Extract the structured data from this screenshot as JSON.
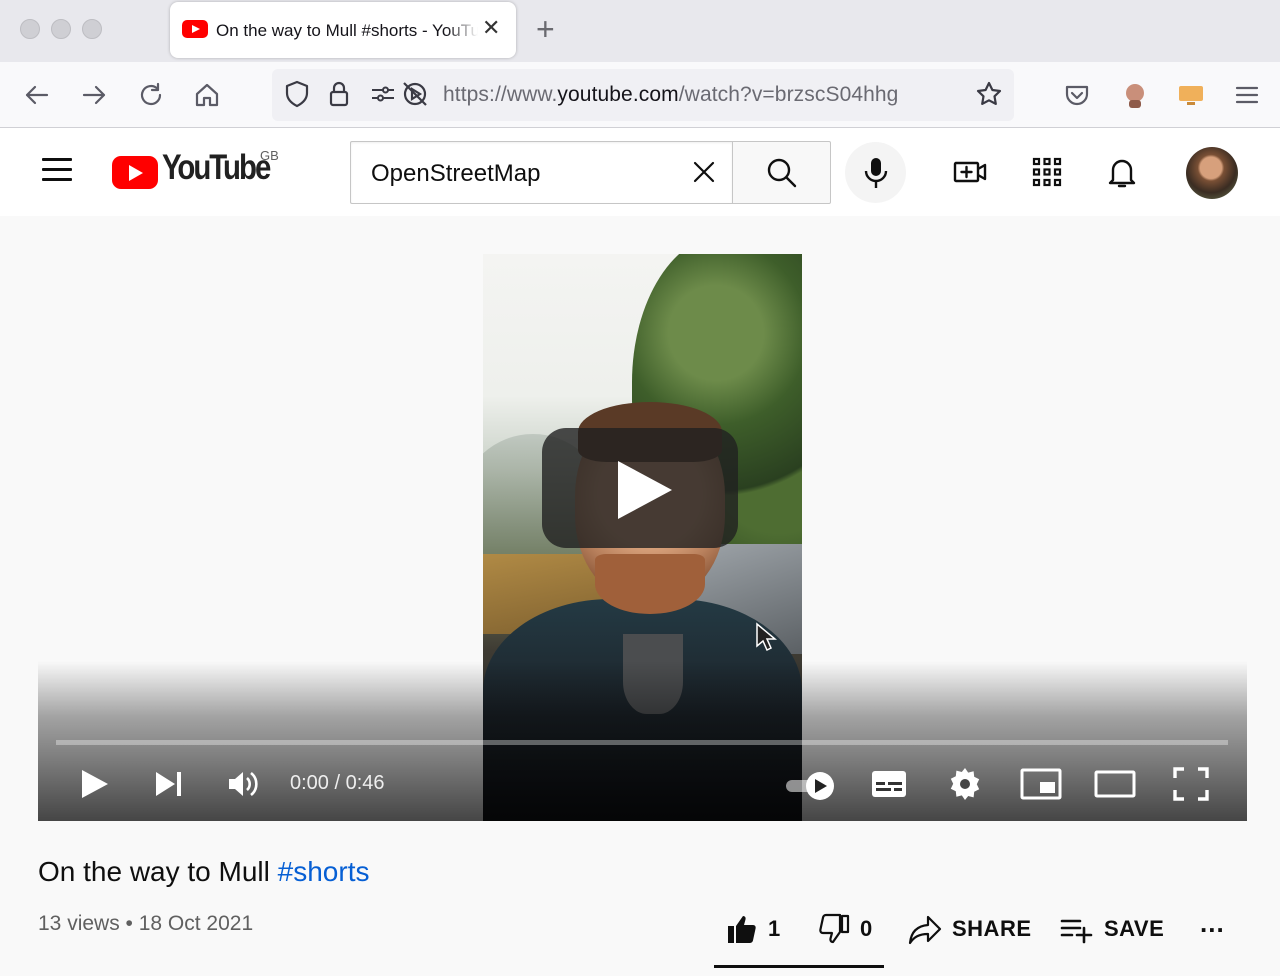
{
  "browser": {
    "tab": {
      "title": "On the way to Mull #shorts - YouTube"
    },
    "url": {
      "prefix": "https://www.",
      "host": "youtube.com",
      "path": "/watch?v=brzscS04hhg"
    }
  },
  "masthead": {
    "logo_text": "YouTube",
    "country_code": "GB",
    "search": {
      "value": "OpenStreetMap"
    }
  },
  "player": {
    "time": "0:00 / 0:46",
    "progress": 0.0
  },
  "video": {
    "title_main": "On the way to Mull ",
    "title_hashtag": "#shorts",
    "meta": "13 views • 18 Oct 2021",
    "likes": "1",
    "dislikes": "0",
    "share_label": "SHARE",
    "save_label": "SAVE",
    "more_label": "..."
  },
  "colors": {
    "brand_red": "#ff0000",
    "link_blue": "#065fd4"
  }
}
